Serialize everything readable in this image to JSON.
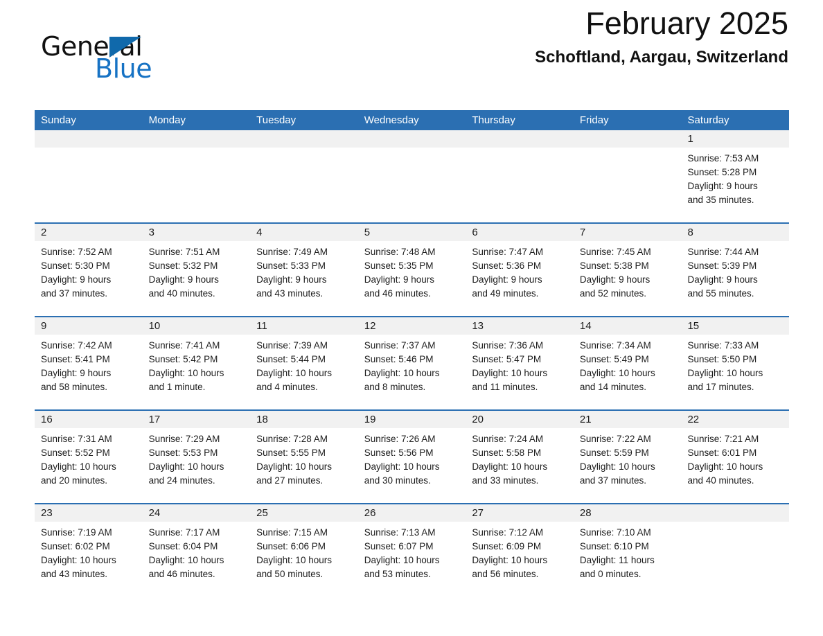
{
  "brand": {
    "name_part1": "General",
    "name_part2": "Blue",
    "accent_color": "#1069ab"
  },
  "header": {
    "title": "February 2025",
    "subtitle": "Schoftland, Aargau, Switzerland"
  },
  "theme": {
    "header_blue": "#2b6fb2",
    "daynum_band": "#f1f1f1",
    "text": "#1c1c1c"
  },
  "weekday_headers": [
    "Sunday",
    "Monday",
    "Tuesday",
    "Wednesday",
    "Thursday",
    "Friday",
    "Saturday"
  ],
  "weeks": [
    [
      {
        "day": "",
        "sunrise": "",
        "sunset": "",
        "daylight_line1": "",
        "daylight_line2": ""
      },
      {
        "day": "",
        "sunrise": "",
        "sunset": "",
        "daylight_line1": "",
        "daylight_line2": ""
      },
      {
        "day": "",
        "sunrise": "",
        "sunset": "",
        "daylight_line1": "",
        "daylight_line2": ""
      },
      {
        "day": "",
        "sunrise": "",
        "sunset": "",
        "daylight_line1": "",
        "daylight_line2": ""
      },
      {
        "day": "",
        "sunrise": "",
        "sunset": "",
        "daylight_line1": "",
        "daylight_line2": ""
      },
      {
        "day": "",
        "sunrise": "",
        "sunset": "",
        "daylight_line1": "",
        "daylight_line2": ""
      },
      {
        "day": "1",
        "sunrise": "Sunrise: 7:53 AM",
        "sunset": "Sunset: 5:28 PM",
        "daylight_line1": "Daylight: 9 hours",
        "daylight_line2": "and 35 minutes."
      }
    ],
    [
      {
        "day": "2",
        "sunrise": "Sunrise: 7:52 AM",
        "sunset": "Sunset: 5:30 PM",
        "daylight_line1": "Daylight: 9 hours",
        "daylight_line2": "and 37 minutes."
      },
      {
        "day": "3",
        "sunrise": "Sunrise: 7:51 AM",
        "sunset": "Sunset: 5:32 PM",
        "daylight_line1": "Daylight: 9 hours",
        "daylight_line2": "and 40 minutes."
      },
      {
        "day": "4",
        "sunrise": "Sunrise: 7:49 AM",
        "sunset": "Sunset: 5:33 PM",
        "daylight_line1": "Daylight: 9 hours",
        "daylight_line2": "and 43 minutes."
      },
      {
        "day": "5",
        "sunrise": "Sunrise: 7:48 AM",
        "sunset": "Sunset: 5:35 PM",
        "daylight_line1": "Daylight: 9 hours",
        "daylight_line2": "and 46 minutes."
      },
      {
        "day": "6",
        "sunrise": "Sunrise: 7:47 AM",
        "sunset": "Sunset: 5:36 PM",
        "daylight_line1": "Daylight: 9 hours",
        "daylight_line2": "and 49 minutes."
      },
      {
        "day": "7",
        "sunrise": "Sunrise: 7:45 AM",
        "sunset": "Sunset: 5:38 PM",
        "daylight_line1": "Daylight: 9 hours",
        "daylight_line2": "and 52 minutes."
      },
      {
        "day": "8",
        "sunrise": "Sunrise: 7:44 AM",
        "sunset": "Sunset: 5:39 PM",
        "daylight_line1": "Daylight: 9 hours",
        "daylight_line2": "and 55 minutes."
      }
    ],
    [
      {
        "day": "9",
        "sunrise": "Sunrise: 7:42 AM",
        "sunset": "Sunset: 5:41 PM",
        "daylight_line1": "Daylight: 9 hours",
        "daylight_line2": "and 58 minutes."
      },
      {
        "day": "10",
        "sunrise": "Sunrise: 7:41 AM",
        "sunset": "Sunset: 5:42 PM",
        "daylight_line1": "Daylight: 10 hours",
        "daylight_line2": "and 1 minute."
      },
      {
        "day": "11",
        "sunrise": "Sunrise: 7:39 AM",
        "sunset": "Sunset: 5:44 PM",
        "daylight_line1": "Daylight: 10 hours",
        "daylight_line2": "and 4 minutes."
      },
      {
        "day": "12",
        "sunrise": "Sunrise: 7:37 AM",
        "sunset": "Sunset: 5:46 PM",
        "daylight_line1": "Daylight: 10 hours",
        "daylight_line2": "and 8 minutes."
      },
      {
        "day": "13",
        "sunrise": "Sunrise: 7:36 AM",
        "sunset": "Sunset: 5:47 PM",
        "daylight_line1": "Daylight: 10 hours",
        "daylight_line2": "and 11 minutes."
      },
      {
        "day": "14",
        "sunrise": "Sunrise: 7:34 AM",
        "sunset": "Sunset: 5:49 PM",
        "daylight_line1": "Daylight: 10 hours",
        "daylight_line2": "and 14 minutes."
      },
      {
        "day": "15",
        "sunrise": "Sunrise: 7:33 AM",
        "sunset": "Sunset: 5:50 PM",
        "daylight_line1": "Daylight: 10 hours",
        "daylight_line2": "and 17 minutes."
      }
    ],
    [
      {
        "day": "16",
        "sunrise": "Sunrise: 7:31 AM",
        "sunset": "Sunset: 5:52 PM",
        "daylight_line1": "Daylight: 10 hours",
        "daylight_line2": "and 20 minutes."
      },
      {
        "day": "17",
        "sunrise": "Sunrise: 7:29 AM",
        "sunset": "Sunset: 5:53 PM",
        "daylight_line1": "Daylight: 10 hours",
        "daylight_line2": "and 24 minutes."
      },
      {
        "day": "18",
        "sunrise": "Sunrise: 7:28 AM",
        "sunset": "Sunset: 5:55 PM",
        "daylight_line1": "Daylight: 10 hours",
        "daylight_line2": "and 27 minutes."
      },
      {
        "day": "19",
        "sunrise": "Sunrise: 7:26 AM",
        "sunset": "Sunset: 5:56 PM",
        "daylight_line1": "Daylight: 10 hours",
        "daylight_line2": "and 30 minutes."
      },
      {
        "day": "20",
        "sunrise": "Sunrise: 7:24 AM",
        "sunset": "Sunset: 5:58 PM",
        "daylight_line1": "Daylight: 10 hours",
        "daylight_line2": "and 33 minutes."
      },
      {
        "day": "21",
        "sunrise": "Sunrise: 7:22 AM",
        "sunset": "Sunset: 5:59 PM",
        "daylight_line1": "Daylight: 10 hours",
        "daylight_line2": "and 37 minutes."
      },
      {
        "day": "22",
        "sunrise": "Sunrise: 7:21 AM",
        "sunset": "Sunset: 6:01 PM",
        "daylight_line1": "Daylight: 10 hours",
        "daylight_line2": "and 40 minutes."
      }
    ],
    [
      {
        "day": "23",
        "sunrise": "Sunrise: 7:19 AM",
        "sunset": "Sunset: 6:02 PM",
        "daylight_line1": "Daylight: 10 hours",
        "daylight_line2": "and 43 minutes."
      },
      {
        "day": "24",
        "sunrise": "Sunrise: 7:17 AM",
        "sunset": "Sunset: 6:04 PM",
        "daylight_line1": "Daylight: 10 hours",
        "daylight_line2": "and 46 minutes."
      },
      {
        "day": "25",
        "sunrise": "Sunrise: 7:15 AM",
        "sunset": "Sunset: 6:06 PM",
        "daylight_line1": "Daylight: 10 hours",
        "daylight_line2": "and 50 minutes."
      },
      {
        "day": "26",
        "sunrise": "Sunrise: 7:13 AM",
        "sunset": "Sunset: 6:07 PM",
        "daylight_line1": "Daylight: 10 hours",
        "daylight_line2": "and 53 minutes."
      },
      {
        "day": "27",
        "sunrise": "Sunrise: 7:12 AM",
        "sunset": "Sunset: 6:09 PM",
        "daylight_line1": "Daylight: 10 hours",
        "daylight_line2": "and 56 minutes."
      },
      {
        "day": "28",
        "sunrise": "Sunrise: 7:10 AM",
        "sunset": "Sunset: 6:10 PM",
        "daylight_line1": "Daylight: 11 hours",
        "daylight_line2": "and 0 minutes."
      },
      {
        "day": "",
        "sunrise": "",
        "sunset": "",
        "daylight_line1": "",
        "daylight_line2": ""
      }
    ]
  ]
}
